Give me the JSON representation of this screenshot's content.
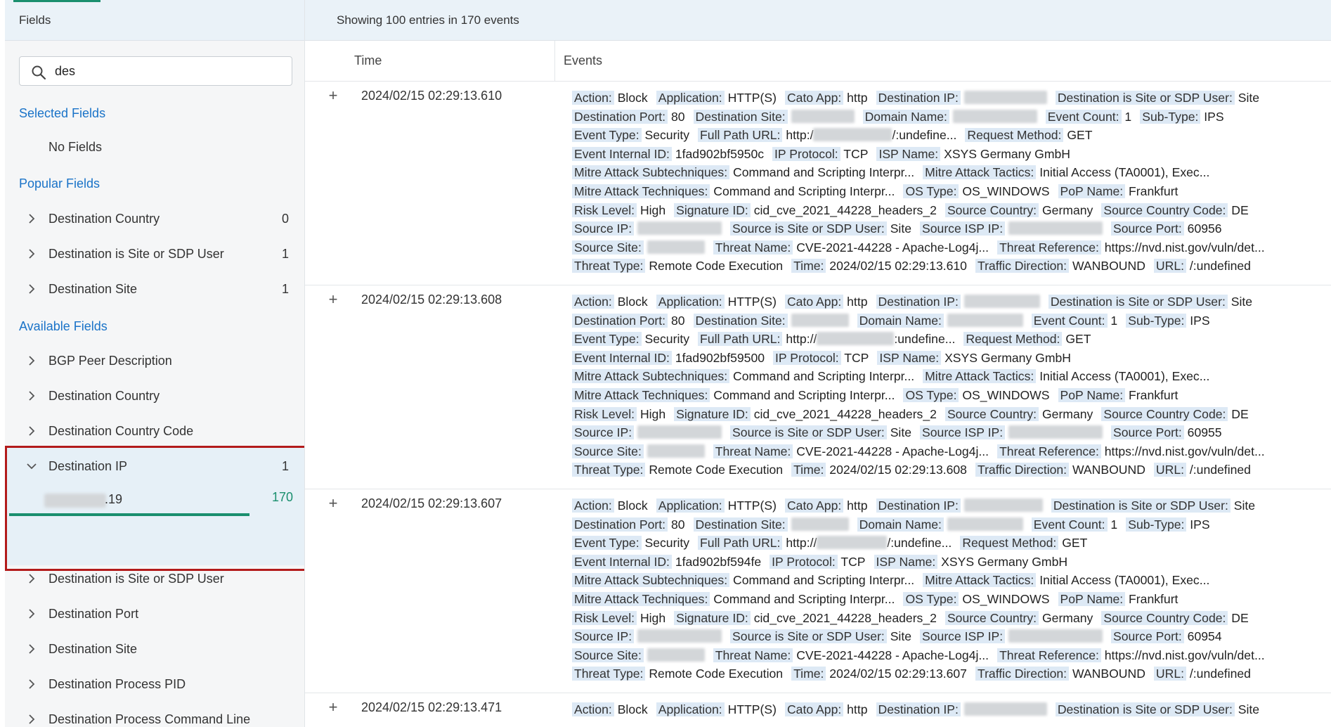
{
  "left_panel": {
    "title": "Fields",
    "search": {
      "value": "des",
      "placeholder": ""
    },
    "selected_fields": {
      "header": "Selected Fields",
      "empty": "No Fields"
    },
    "popular_fields": {
      "header": "Popular Fields",
      "items": [
        {
          "label": "Destination Country",
          "count": "0"
        },
        {
          "label": "Destination is Site or SDP User",
          "count": "1"
        },
        {
          "label": "Destination Site",
          "count": "1"
        }
      ]
    },
    "available_fields": {
      "header": "Available Fields",
      "items_before": [
        {
          "label": "BGP Peer Description"
        },
        {
          "label": "Destination Country"
        },
        {
          "label": "Destination Country Code"
        }
      ],
      "expanded": {
        "label": "Destination IP",
        "count": "1",
        "value_suffix": ".19",
        "value_count": "170",
        "value_share": 1.0
      },
      "items_after": [
        {
          "label": "Destination is Site or SDP User"
        },
        {
          "label": "Destination Port"
        },
        {
          "label": "Destination Site"
        },
        {
          "label": "Destination Process PID"
        },
        {
          "label": "Destination Process Command Line"
        }
      ]
    }
  },
  "right_panel": {
    "info": "Showing 100 entries in 170 events",
    "columns": {
      "time": "Time",
      "events": "Events"
    },
    "events": [
      {
        "time": "2024/02/15 02:29:13.610",
        "lines": [
          [
            [
              "Action:",
              "Block"
            ],
            [
              "Application:",
              "HTTP(S)"
            ],
            [
              "Cato App:",
              "http"
            ],
            [
              "Destination IP:",
              null,
              118
            ],
            [
              "Destination is Site or SDP User:",
              "Site"
            ]
          ],
          [
            [
              "Destination Port:",
              "80"
            ],
            [
              "Destination Site:",
              null,
              90
            ],
            [
              "Domain Name:",
              null,
              120
            ],
            [
              "Event Count:",
              "1"
            ],
            [
              "Sub-Type:",
              "IPS"
            ]
          ],
          [
            [
              "Event Type:",
              "Security"
            ],
            [
              "Full Path URL:",
              "http:/",
              112,
              "/:undefine..."
            ],
            [
              "Request Method:",
              "GET"
            ]
          ],
          [
            [
              "Event Internal ID:",
              "1fad902bf5950c"
            ],
            [
              "IP Protocol:",
              "TCP"
            ],
            [
              "ISP Name:",
              "XSYS Germany GmbH"
            ]
          ],
          [
            [
              "Mitre Attack Subtechniques:",
              "Command and Scripting Interpr..."
            ],
            [
              "Mitre Attack Tactics:",
              "Initial Access (TA0001), Exec..."
            ]
          ],
          [
            [
              "Mitre Attack Techniques:",
              "Command and Scripting Interpr..."
            ],
            [
              "OS Type:",
              "OS_WINDOWS"
            ],
            [
              "PoP Name:",
              "Frankfurt"
            ]
          ],
          [
            [
              "Risk Level:",
              "High"
            ],
            [
              "Signature ID:",
              "cid_cve_2021_44228_headers_2"
            ],
            [
              "Source Country:",
              "Germany"
            ],
            [
              "Source Country Code:",
              "DE"
            ]
          ],
          [
            [
              "Source IP:",
              null,
              120
            ],
            [
              "Source is Site or SDP User:",
              "Site"
            ],
            [
              "Source ISP IP:",
              null,
              134
            ],
            [
              "Source Port:",
              "60956"
            ]
          ],
          [
            [
              "Source Site:",
              null,
              82
            ],
            [
              "Threat Name:",
              "CVE-2021-44228 - Apache-Log4j..."
            ],
            [
              "Threat Reference:",
              "https://nvd.nist.gov/vuln/det..."
            ]
          ],
          [
            [
              "Threat Type:",
              "Remote Code Execution"
            ],
            [
              "Time:",
              "2024/02/15 02:29:13.610"
            ],
            [
              "Traffic Direction:",
              "WANBOUND"
            ],
            [
              "URL:",
              "/:undefined"
            ]
          ]
        ]
      },
      {
        "time": "2024/02/15 02:29:13.608",
        "lines": [
          [
            [
              "Action:",
              "Block"
            ],
            [
              "Application:",
              "HTTP(S)"
            ],
            [
              "Cato App:",
              "http"
            ],
            [
              "Destination IP:",
              null,
              108
            ],
            [
              "Destination is Site or SDP User:",
              "Site"
            ]
          ],
          [
            [
              "Destination Port:",
              "80"
            ],
            [
              "Destination Site:",
              null,
              82
            ],
            [
              "Domain Name:",
              null,
              108
            ],
            [
              "Event Count:",
              "1"
            ],
            [
              "Sub-Type:",
              "IPS"
            ]
          ],
          [
            [
              "Event Type:",
              "Security"
            ],
            [
              "Full Path URL:",
              "http://",
              110,
              ":undefine..."
            ],
            [
              "Request Method:",
              "GET"
            ]
          ],
          [
            [
              "Event Internal ID:",
              "1fad902bf59500"
            ],
            [
              "IP Protocol:",
              "TCP"
            ],
            [
              "ISP Name:",
              "XSYS Germany GmbH"
            ]
          ],
          [
            [
              "Mitre Attack Subtechniques:",
              "Command and Scripting Interpr..."
            ],
            [
              "Mitre Attack Tactics:",
              "Initial Access (TA0001), Exec..."
            ]
          ],
          [
            [
              "Mitre Attack Techniques:",
              "Command and Scripting Interpr..."
            ],
            [
              "OS Type:",
              "OS_WINDOWS"
            ],
            [
              "PoP Name:",
              "Frankfurt"
            ]
          ],
          [
            [
              "Risk Level:",
              "High"
            ],
            [
              "Signature ID:",
              "cid_cve_2021_44228_headers_2"
            ],
            [
              "Source Country:",
              "Germany"
            ],
            [
              "Source Country Code:",
              "DE"
            ]
          ],
          [
            [
              "Source IP:",
              null,
              120
            ],
            [
              "Source is Site or SDP User:",
              "Site"
            ],
            [
              "Source ISP IP:",
              null,
              134
            ],
            [
              "Source Port:",
              "60955"
            ]
          ],
          [
            [
              "Source Site:",
              null,
              82
            ],
            [
              "Threat Name:",
              "CVE-2021-44228 - Apache-Log4j..."
            ],
            [
              "Threat Reference:",
              "https://nvd.nist.gov/vuln/det..."
            ]
          ],
          [
            [
              "Threat Type:",
              "Remote Code Execution"
            ],
            [
              "Time:",
              "2024/02/15 02:29:13.608"
            ],
            [
              "Traffic Direction:",
              "WANBOUND"
            ],
            [
              "URL:",
              "/:undefined"
            ]
          ]
        ]
      },
      {
        "time": "2024/02/15 02:29:13.607",
        "lines": [
          [
            [
              "Action:",
              "Block"
            ],
            [
              "Application:",
              "HTTP(S)"
            ],
            [
              "Cato App:",
              "http"
            ],
            [
              "Destination IP:",
              null,
              112
            ],
            [
              "Destination is Site or SDP User:",
              "Site"
            ]
          ],
          [
            [
              "Destination Port:",
              "80"
            ],
            [
              "Destination Site:",
              null,
              82
            ],
            [
              "Domain Name:",
              null,
              108
            ],
            [
              "Event Count:",
              "1"
            ],
            [
              "Sub-Type:",
              "IPS"
            ]
          ],
          [
            [
              "Event Type:",
              "Security"
            ],
            [
              "Full Path URL:",
              "http://",
              100,
              "/:undefine..."
            ],
            [
              "Request Method:",
              "GET"
            ]
          ],
          [
            [
              "Event Internal ID:",
              "1fad902bf594fe"
            ],
            [
              "IP Protocol:",
              "TCP"
            ],
            [
              "ISP Name:",
              "XSYS Germany GmbH"
            ]
          ],
          [
            [
              "Mitre Attack Subtechniques:",
              "Command and Scripting Interpr..."
            ],
            [
              "Mitre Attack Tactics:",
              "Initial Access (TA0001), Exec..."
            ]
          ],
          [
            [
              "Mitre Attack Techniques:",
              "Command and Scripting Interpr..."
            ],
            [
              "OS Type:",
              "OS_WINDOWS"
            ],
            [
              "PoP Name:",
              "Frankfurt"
            ]
          ],
          [
            [
              "Risk Level:",
              "High"
            ],
            [
              "Signature ID:",
              "cid_cve_2021_44228_headers_2"
            ],
            [
              "Source Country:",
              "Germany"
            ],
            [
              "Source Country Code:",
              "DE"
            ]
          ],
          [
            [
              "Source IP:",
              null,
              120
            ],
            [
              "Source is Site or SDP User:",
              "Site"
            ],
            [
              "Source ISP IP:",
              null,
              134
            ],
            [
              "Source Port:",
              "60954"
            ]
          ],
          [
            [
              "Source Site:",
              null,
              82
            ],
            [
              "Threat Name:",
              "CVE-2021-44228 - Apache-Log4j..."
            ],
            [
              "Threat Reference:",
              "https://nvd.nist.gov/vuln/det..."
            ]
          ],
          [
            [
              "Threat Type:",
              "Remote Code Execution"
            ],
            [
              "Time:",
              "2024/02/15 02:29:13.607"
            ],
            [
              "Traffic Direction:",
              "WANBOUND"
            ],
            [
              "URL:",
              "/:undefined"
            ]
          ]
        ]
      },
      {
        "time": "2024/02/15 02:29:13.471",
        "lines": [
          [
            [
              "Action:",
              "Block"
            ],
            [
              "Application:",
              "HTTP(S)"
            ],
            [
              "Cato App:",
              "http"
            ],
            [
              "Destination IP:",
              null,
              118
            ],
            [
              "Destination is Site or SDP User:",
              "Site"
            ]
          ]
        ]
      }
    ]
  },
  "colors": {
    "accent": "#1a73c8",
    "bar": "#1a8f6e",
    "highlight_border": "#b31b1b",
    "key_bg": "#dde9f5"
  }
}
